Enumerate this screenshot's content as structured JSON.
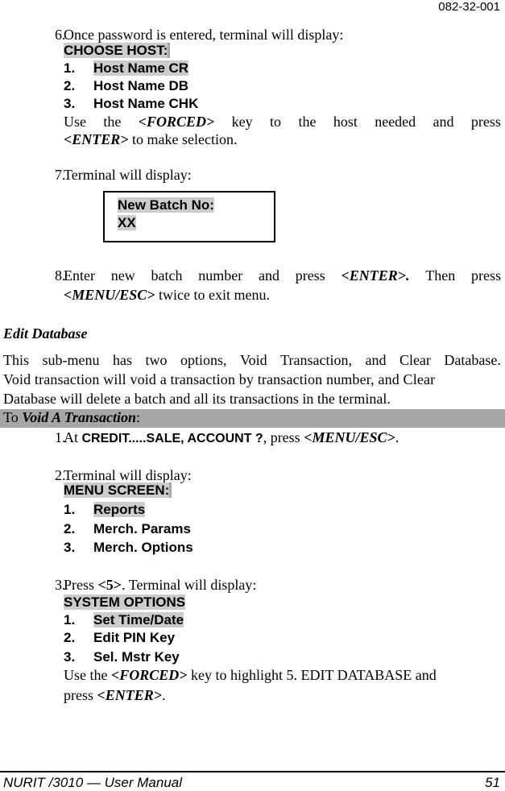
{
  "header": {
    "doc_number": "082-32-001"
  },
  "step6": {
    "num": "6.",
    "text": "Once password is entered, terminal will display:",
    "menu_title": "CHOOSE HOST:",
    "items": [
      {
        "num": "1.",
        "label": "Host Name CR",
        "highlighted": true
      },
      {
        "num": "2.",
        "label": "Host Name DB",
        "highlighted": false
      },
      {
        "num": "3.",
        "label": "Host Name CHK",
        "highlighted": false
      }
    ],
    "instr_words": [
      "Use",
      "the",
      "<FORCED>",
      "key",
      "to",
      "the",
      "host",
      "needed",
      "and",
      "press"
    ],
    "instr_line2_key": "<ENTER>",
    "instr_line2_rest": " to make selection."
  },
  "step7": {
    "num": "7.",
    "text": "Terminal will display:",
    "box_line1": "New Batch No:",
    "box_line2": "XX"
  },
  "step8": {
    "num": "8.",
    "line1_words": [
      "Enter",
      "new",
      "batch",
      "number",
      "and",
      "press",
      "<ENTER>.",
      "Then",
      "press"
    ],
    "line2_key": "<MENU/ESC>",
    "line2_rest": " twice to exit menu."
  },
  "edit_database": {
    "heading": "Edit Database",
    "para_line1_words": [
      "This",
      "sub-menu",
      "has",
      "two",
      "options,",
      "Void",
      "Transaction,",
      "and",
      "Clear",
      "Database."
    ],
    "para_line2": "Void transaction will void a transaction by transaction number, and Clear",
    "para_line3": "Database will delete a batch and all its transactions in the terminal."
  },
  "void_banner": {
    "prefix": "To ",
    "title": "Void A Transaction",
    "suffix": ":"
  },
  "void_steps": {
    "step1": {
      "num": "1.",
      "at": "At ",
      "prompt": "CREDIT.....SALE, ACCOUNT ?",
      "mid": ", press ",
      "key": "<MENU/ESC>",
      "end": "."
    },
    "step2": {
      "num": "2.",
      "text": "Terminal will display:",
      "menu_title": "MENU SCREEN:",
      "items": [
        {
          "num": "1.",
          "label": "Reports",
          "highlighted": true
        },
        {
          "num": "2.",
          "label": "Merch. Params",
          "highlighted": false
        },
        {
          "num": "3.",
          "label": "Merch. Options",
          "highlighted": false
        }
      ]
    },
    "step3": {
      "num": "3.",
      "press": "Press ",
      "key": "<5>",
      "rest": ". Terminal will display:",
      "menu_title": "SYSTEM OPTIONS",
      "items": [
        {
          "num": "1.",
          "label": "Set Time/Date",
          "highlighted": true
        },
        {
          "num": "2.",
          "label": "Edit PIN Key",
          "highlighted": false
        },
        {
          "num": "3.",
          "label": "Sel. Mstr Key",
          "highlighted": false
        }
      ],
      "instr_pre": "Use the ",
      "instr_key": "<FORCED>",
      "instr_post": " key to highlight 5. EDIT DATABASE and",
      "instr2_pre": "press ",
      "instr2_key": "<ENTER>",
      "instr2_post": "."
    }
  },
  "footer": {
    "title": "NURIT /3010 — User Manual",
    "page": "51"
  },
  "colors": {
    "highlight": "#cccccc",
    "banner": "#a6a6a6",
    "text": "#000000"
  }
}
